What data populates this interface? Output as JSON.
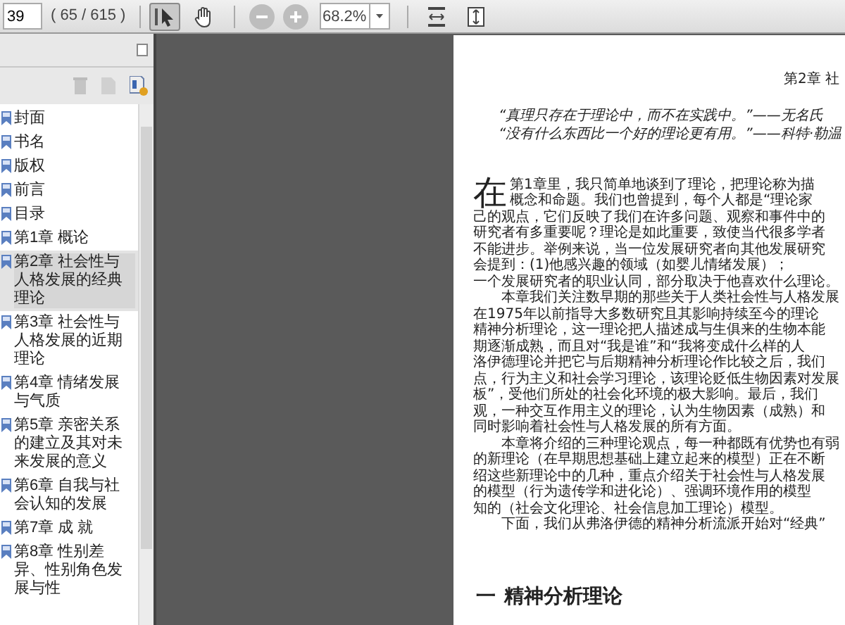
{
  "toolbar": {
    "page_field": {
      "value": "39"
    },
    "page_count": "( 65 / 615 )",
    "tools": [
      {
        "kind": "select",
        "selected": true
      },
      {
        "kind": "hand",
        "selected": false
      }
    ],
    "zoom_field": {
      "value": "68.2%"
    }
  },
  "sidebar": {
    "items": [
      {
        "label": "封面",
        "selected": false
      },
      {
        "label": "书名",
        "selected": false
      },
      {
        "label": "版权",
        "selected": false
      },
      {
        "label": "前言",
        "selected": false
      },
      {
        "label": "目录",
        "selected": false
      },
      {
        "label": "第1章 概论",
        "selected": false
      },
      {
        "label": "第2章 社会性与人格发展的经典理论",
        "selected": true
      },
      {
        "label": "第3章 社会性与人格发展的近期理论",
        "selected": false
      },
      {
        "label": "第4章 情绪发展与气质",
        "selected": false
      },
      {
        "label": "第5章 亲密关系的建立及其对未来发展的意义",
        "selected": false
      },
      {
        "label": "第6章 自我与社会认知的发展",
        "selected": false
      },
      {
        "label": "第7章 成 就",
        "selected": false
      },
      {
        "label": "第8章 性别差异、性别角色发展与性",
        "selected": false
      }
    ]
  },
  "document": {
    "running_head": "第2章  社",
    "epigraphs": [
      "“真理只存在于理论中，而不在实践中。”——无名氏",
      "“没有什么东西比一个好的理论更有用。”——科特·勒温"
    ],
    "paragraphs": [
      {
        "drop_cap": "在",
        "lines": [
          "第1章里，我只简单地谈到了理论，把理论称为描",
          "概念和命题。我们也曾提到，每个人都是“理论家",
          "己的观点，它们反映了我们在许多问题、观察和事件中的",
          "研究者有多重要呢？理论是如此重要，致使当代很多学者",
          "不能进步。举例来说，当一位发展研究者向其他发展研究",
          "会提到：(1)他感兴趣的领域（如婴儿情绪发展）；",
          "一个发展研究者的职业认同，部分取决于他喜欢什么理论。"
        ]
      },
      {
        "lines": [
          "本章我们关注数早期的那些关于人类社会性与人格发展",
          "在1975年以前指导大多数研究且其影响持续至今的理论",
          "精神分析理论，这一理论把人描述成与生俱来的生物本能",
          "期逐渐成熟，而且对“我是谁”和“我将变成什么样的人",
          "洛伊德理论并把它与后期精神分析理论作比较之后，我们",
          "点，行为主义和社会学习理论，该理论贬低生物因素对发展",
          "板”，受他们所处的社会化环境的极大影响。最后，我们",
          "观，一种交互作用主义的理论，认为生物因素（成熟）和",
          "同时影响着社会性与人格发展的所有方面。"
        ]
      },
      {
        "lines": [
          "本章将介绍的三种理论观点，每一种都既有优势也有弱",
          "的新理论（在早期思想基础上建立起来的模型）正在不断",
          "绍这些新理论中的几种，重点介绍关于社会性与人格发展",
          "的模型（行为遗传学和进化论）、强调环境作用的模型",
          "知的（社会文化理论、社会信息加工理论）模型。"
        ]
      },
      {
        "lines": [
          "下面，我们从弗洛伊德的精神分析流派开始对“经典”"
        ]
      }
    ],
    "section_heading": {
      "number": "一",
      "title": "精神分析理论"
    }
  }
}
